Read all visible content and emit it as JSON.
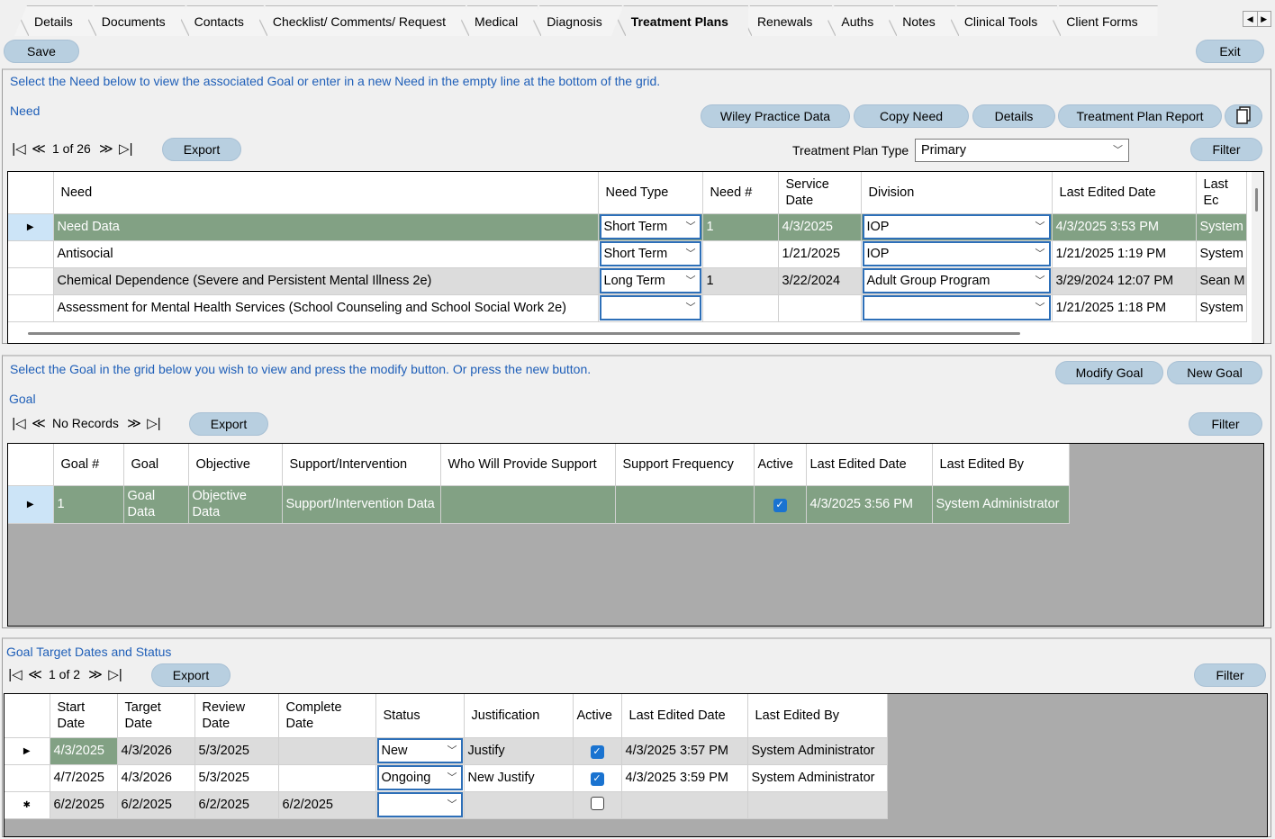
{
  "tabs": [
    "Details",
    "Documents",
    "Contacts",
    "Checklist/ Comments/ Request",
    "Medical",
    "Diagnosis",
    "Treatment Plans",
    "Renewals",
    "Auths",
    "Notes",
    "Clinical Tools",
    "Client Forms"
  ],
  "active_tab": "Treatment Plans",
  "toolbar": {
    "save": "Save",
    "exit": "Exit"
  },
  "need": {
    "instruction": "Select the Need below to view the associated Goal or enter in a new Need in the empty line at the bottom of the grid.",
    "label": "Need",
    "buttons": {
      "wiley": "Wiley Practice Data",
      "copy": "Copy Need",
      "details": "Details",
      "report": "Treatment Plan Report"
    },
    "pager": "1 of 26",
    "export": "Export",
    "plan_type_label": "Treatment Plan Type",
    "plan_type_value": "Primary",
    "filter": "Filter",
    "columns": [
      "Need",
      "Need Type",
      "Need #",
      "Service Date",
      "Division",
      "Last Edited Date",
      "Last Ec"
    ],
    "rows": [
      {
        "need": "Need Data",
        "type": "Short Term",
        "num": "1",
        "service": "4/3/2025",
        "division": "IOP",
        "edited": "4/3/2025 3:53 PM",
        "by": "System"
      },
      {
        "need": "Antisocial",
        "type": "Short Term",
        "num": "",
        "service": "1/21/2025",
        "division": "IOP",
        "edited": "1/21/2025 1:19 PM",
        "by": "System"
      },
      {
        "need": "Chemical Dependence (Severe and Persistent Mental Illness 2e)",
        "type": "Long Term",
        "num": "1",
        "service": "3/22/2024",
        "division": "Adult Group Program",
        "edited": "3/29/2024 12:07 PM",
        "by": "Sean M"
      },
      {
        "need": "Assessment for Mental Health Services (School Counseling and School Social Work 2e)",
        "type": "",
        "num": "",
        "service": "",
        "division": "",
        "edited": "1/21/2025 1:18 PM",
        "by": "System"
      }
    ]
  },
  "goal": {
    "instruction": "Select the Goal in the grid below you wish to view and press the modify button. Or press the new button.",
    "label": "Goal",
    "buttons": {
      "modify": "Modify Goal",
      "new": "New Goal"
    },
    "pager": "No Records",
    "export": "Export",
    "filter": "Filter",
    "columns": [
      "Goal #",
      "Goal",
      "Objective",
      "Support/Intervention",
      "Who Will Provide Support",
      "Support Frequency",
      "Active",
      "Last Edited Date",
      "Last Edited By"
    ],
    "rows": [
      {
        "num": "1",
        "goal": "Goal Data",
        "objective": "Objective Data",
        "support": "Support/Intervention Data",
        "who": "",
        "freq": "",
        "active": true,
        "edited": "4/3/2025 3:56 PM",
        "by": "System Administrator"
      }
    ]
  },
  "targets": {
    "label": "Goal  Target Dates and Status",
    "pager": "1 of 2",
    "export": "Export",
    "filter": "Filter",
    "columns": [
      "Start Date",
      "Target Date",
      "Review Date",
      "Complete Date",
      "Status",
      "Justification",
      "Active",
      "Last Edited Date",
      "Last Edited By"
    ],
    "rows": [
      {
        "start": "4/3/2025",
        "target": "4/3/2026",
        "review": "5/3/2025",
        "complete": "",
        "status": "New",
        "just": "Justify",
        "active": true,
        "edited": "4/3/2025 3:57 PM",
        "by": "System Administrator"
      },
      {
        "start": "4/7/2025",
        "target": "4/3/2026",
        "review": "5/3/2025",
        "complete": "",
        "status": "Ongoing",
        "just": "New Justify",
        "active": true,
        "edited": "4/3/2025 3:59 PM",
        "by": "System Administrator"
      },
      {
        "start": "6/2/2025",
        "target": "6/2/2025",
        "review": "6/2/2025",
        "complete": "6/2/2025",
        "status": "",
        "just": "",
        "active": false,
        "edited": "",
        "by": ""
      }
    ]
  }
}
